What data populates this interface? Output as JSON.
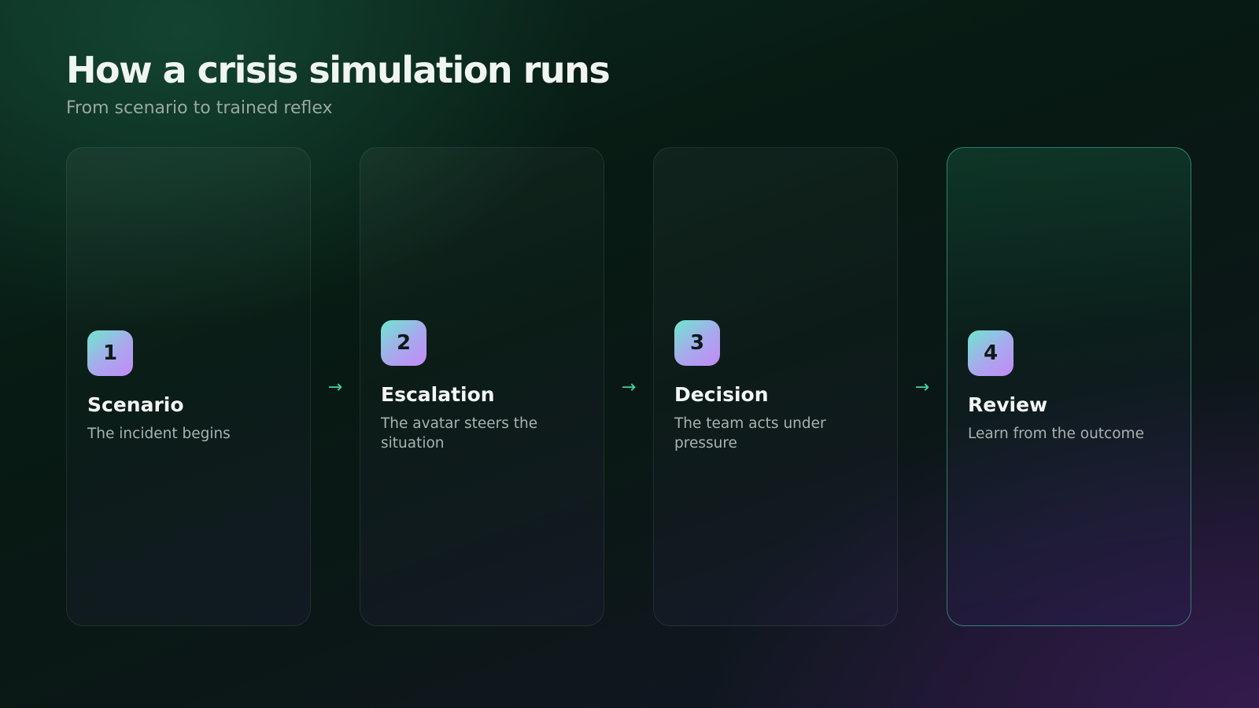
{
  "header": {
    "title": "How a crisis simulation runs",
    "subtitle": "From scenario to trained reflex"
  },
  "steps": [
    {
      "number": "1",
      "title": "Scenario",
      "description": "The incident begins"
    },
    {
      "number": "2",
      "title": "Escalation",
      "description": "The avatar steers the situation"
    },
    {
      "number": "3",
      "title": "Decision",
      "description": "The team acts under pressure"
    },
    {
      "number": "4",
      "title": "Review",
      "description": "Learn from the outcome"
    }
  ],
  "arrow_glyph": "→",
  "colors": {
    "accent": "#3fd3a8",
    "badge_start": "#6fe6cf",
    "badge_end": "#c38af6",
    "highlight_border": "#48c8aa"
  },
  "active_step": "4",
  "icons": {
    "connector": "arrow-right-icon"
  }
}
